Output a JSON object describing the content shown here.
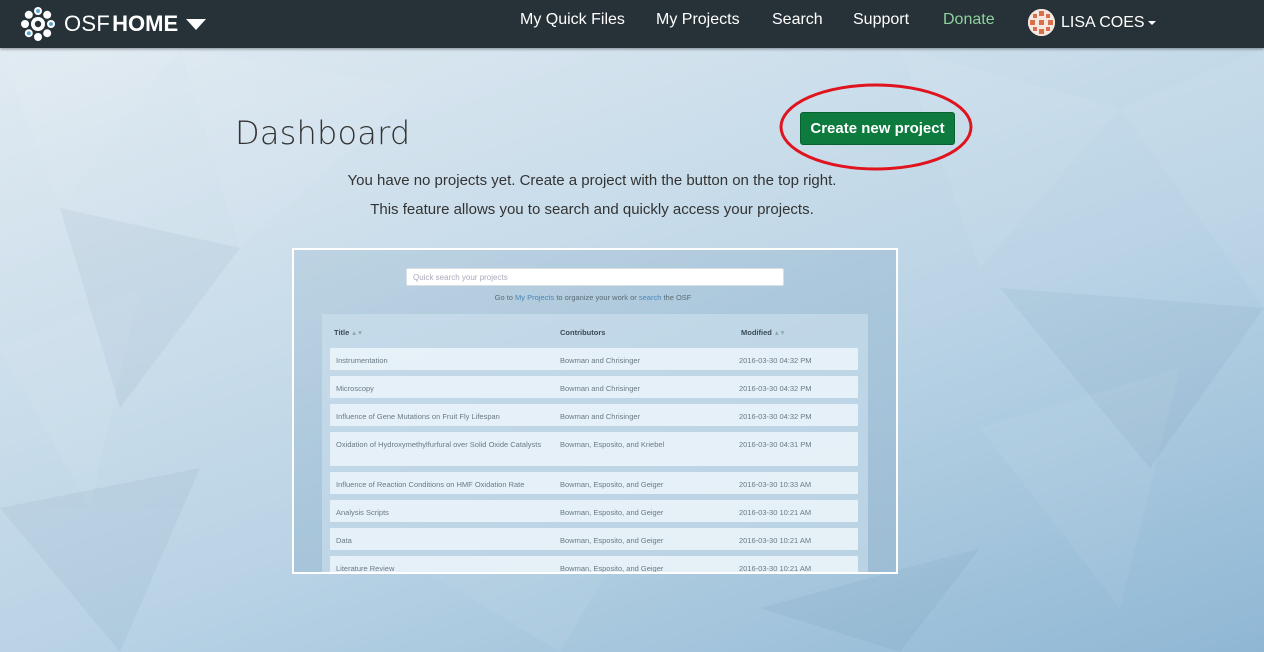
{
  "navbar": {
    "brand_osf": "OSF",
    "brand_home": "HOME",
    "links": [
      "My Quick Files",
      "My Projects",
      "Search",
      "Support",
      "Donate"
    ],
    "user_name": "LISA COES",
    "bg_color": "#263238",
    "donate_color": "#8fd19e"
  },
  "main": {
    "title": "Dashboard",
    "create_button": "Create new project",
    "message_1": "You have no projects yet. Create a project with the button on the top right.",
    "message_2": "This feature allows you to search and quickly access your projects.",
    "button_color": "#0d7a3e",
    "highlight_color": "#e0141e"
  },
  "preview": {
    "search_placeholder": "Quick search your projects",
    "goto_pre": "Go to ",
    "goto_link1": "My Projects",
    "goto_mid": " to organize your work or ",
    "goto_link2": "search",
    "goto_post": " the OSF",
    "headers": {
      "title": "Title",
      "contributors": "Contributors",
      "modified": "Modified"
    },
    "rows": [
      {
        "title": "Instrumentation",
        "contributors": "Bowman and Chrisinger",
        "modified": "2016-03-30 04:32 PM"
      },
      {
        "title": "Microscopy",
        "contributors": "Bowman and Chrisinger",
        "modified": "2016-03-30 04:32 PM"
      },
      {
        "title": "Influence of Gene Mutations on Fruit Fly Lifespan",
        "contributors": "Bowman and Chrisinger",
        "modified": "2016-03-30 04:32 PM"
      },
      {
        "title": "Oxidation of Hydroxymethylfurfural over Solid Oxide Catalysts",
        "contributors": "Bowman, Esposito, and Kriebel",
        "modified": "2016-03-30 04:31 PM"
      },
      {
        "title": "Influence of Reaction Conditions on HMF Oxidation Rate",
        "contributors": "Bowman, Esposito, and Geiger",
        "modified": "2016-03-30 10:33 AM"
      },
      {
        "title": "Analysis Scripts",
        "contributors": "Bowman, Esposito, and Geiger",
        "modified": "2016-03-30 10:21 AM"
      },
      {
        "title": "Data",
        "contributors": "Bowman, Esposito, and Geiger",
        "modified": "2016-03-30 10:21 AM"
      },
      {
        "title": "Literature Review",
        "contributors": "Bowman, Esposito, and Geiger",
        "modified": "2016-03-30 10:21 AM"
      }
    ]
  }
}
